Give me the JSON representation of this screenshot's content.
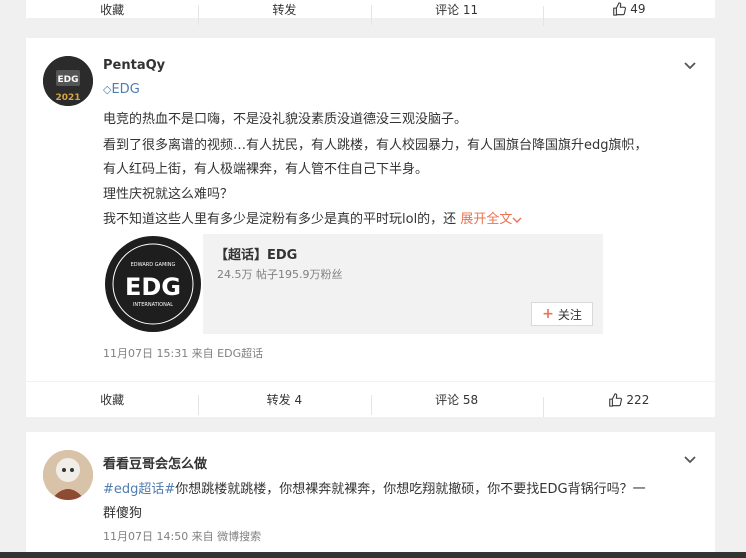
{
  "top_bar": {
    "collect": "收藏",
    "repost": "转发",
    "comment": "评论 11",
    "likes": "49"
  },
  "post": {
    "username": "PentaQy",
    "avatar_logo": "EDG",
    "avatar_year": "2021",
    "verify_tag": "EDG",
    "lines": [
      "电竞的热血不是口嗨，不是没礼貌没素质没道德没三观没脑子。",
      "看到了很多离谱的视频…有人扰民，有人跳楼，有人校园暴力，有人国旗台降国旗升edg旗帜，",
      "有人红码上街，有人极端裸奔，有人管不住自己下半身。",
      "理性庆祝就这么难吗？",
      "我不知道这些人里有多少是淀粉有多少是真的平时玩lol的，还"
    ],
    "expand_label": "展开全文",
    "share_card": {
      "title": "【超话】EDG",
      "stats": "24.5万 帖子195.9万粉丝",
      "follow_label": "关注",
      "logo_text": "EDG",
      "logo_top": "EDWARD GAMING",
      "logo_bottom": "INTERNATIONAL"
    },
    "meta": "11月07日 15:31  来自 EDG超话",
    "actions": {
      "collect": "收藏",
      "repost": "转发 4",
      "comment": "评论 58",
      "likes": "222"
    }
  },
  "comment_post": {
    "username": "看看豆哥会怎么做",
    "hashtag": "#edg超话#",
    "text_line1": "你想跳楼就跳楼，你想裸奔就裸奔，你想吃翔就撤硕，你不要找EDG背锅行吗？一",
    "text_line2": "群傻狗",
    "meta": "11月07日 14:50  来自 微博搜索"
  },
  "colors": {
    "accent_link": "#eb7350",
    "blue_tag": "#507daf",
    "muted": "#808080"
  }
}
